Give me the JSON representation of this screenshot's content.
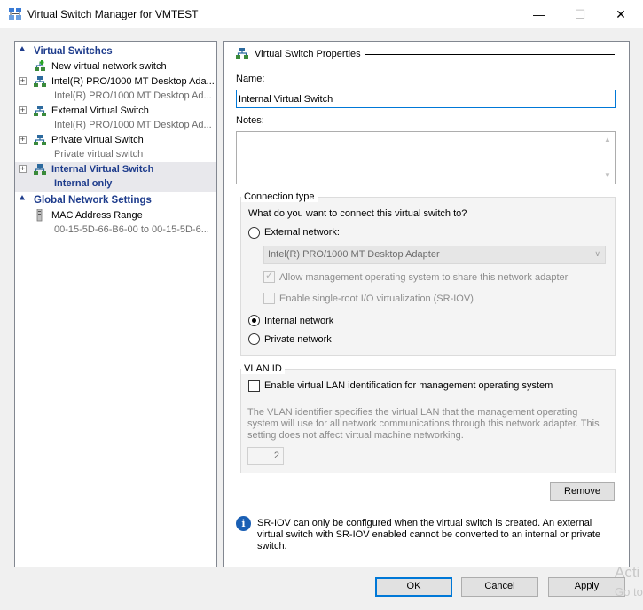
{
  "window": {
    "title": "Virtual Switch Manager for VMTEST",
    "minimize_glyph": "—",
    "maximize_glyph": "☐",
    "close_glyph": "✕"
  },
  "sidebar": {
    "virtual_switches_header": "Virtual Switches",
    "global_settings_header": "Global Network Settings",
    "items": [
      {
        "label": "New virtual network switch",
        "sub": "",
        "icon": "new-switch-icon"
      },
      {
        "label": "Intel(R) PRO/1000 MT Desktop Ada...",
        "sub": "Intel(R) PRO/1000 MT Desktop Ad...",
        "icon": "network-switch-icon"
      },
      {
        "label": "External Virtual Switch",
        "sub": "Intel(R) PRO/1000 MT Desktop Ad...",
        "icon": "network-switch-icon"
      },
      {
        "label": "Private Virtual Switch",
        "sub": "Private virtual switch",
        "icon": "network-switch-icon"
      },
      {
        "label": "Internal Virtual Switch",
        "sub": "Internal only",
        "icon": "network-switch-icon"
      }
    ],
    "global_items": [
      {
        "label": "MAC Address Range",
        "sub": "00-15-5D-66-B6-00 to 00-15-5D-6...",
        "icon": "mac-address-icon"
      }
    ]
  },
  "properties": {
    "header": "Virtual Switch Properties",
    "name_label": "Name:",
    "name_value": "Internal Virtual Switch",
    "notes_label": "Notes:",
    "notes_value": ""
  },
  "connection": {
    "legend": "Connection type",
    "question": "What do you want to connect this virtual switch to?",
    "external_label": "External network:",
    "adapter_value": "Intel(R) PRO/1000 MT Desktop Adapter",
    "allow_mgmt_label": "Allow management operating system to share this network adapter",
    "sriov_label": "Enable single-root I/O virtualization (SR-IOV)",
    "internal_label": "Internal network",
    "private_label": "Private network",
    "selected": "internal"
  },
  "vlan": {
    "legend": "VLAN ID",
    "enable_label": "Enable virtual LAN identification for management operating system",
    "description": "The VLAN identifier specifies the virtual LAN that the management operating system will use for all network communications through this network adapter. This setting does not affect virtual machine networking.",
    "id_value": "2"
  },
  "buttons": {
    "remove": "Remove",
    "ok": "OK",
    "cancel": "Cancel",
    "apply": "Apply"
  },
  "info": {
    "text": "SR-IOV can only be configured when the virtual switch is created. An external virtual switch with SR-IOV enabled cannot be converted to an internal or private switch."
  },
  "watermark": {
    "line1": "Acti",
    "line2": "Go to"
  },
  "colors": {
    "accent": "#0078d7",
    "header_blue": "#1e3c8c",
    "info_blue": "#1a5fb4"
  }
}
